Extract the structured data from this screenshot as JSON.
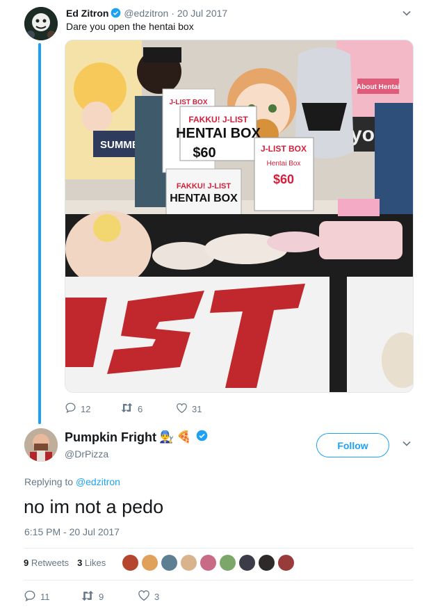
{
  "thread": {
    "parent": {
      "name": "Ed Zitron",
      "handle": "@edzitron",
      "separator": "·",
      "date": "20 Jul 2017",
      "text": "Dare you open the hentai box",
      "counts": {
        "replies": "12",
        "retweets": "6",
        "likes": "31"
      },
      "photo_text": {
        "banner": "J-LIST",
        "sign_box_brand": "FAKKU! J-LIST",
        "sign_box_title": "HENTAI BOX",
        "sign_price": "$60",
        "card_small": "J-LIST BOX",
        "card_right_title": "J-LIST BOX",
        "card_right_sub": "Hentai Box",
        "card_right_price": "$60",
        "box_brand": "FAKKU! J-LIST",
        "box_title": "HENTAI BOX",
        "bg_sign": "SUMME",
        "bg_sign_right": "yo",
        "bg_sign_pink": "About Hentai"
      }
    },
    "reply": {
      "name": "Pumpkin Fright",
      "emoji_1": "👨‍🔧",
      "emoji_2": "🍕",
      "handle": "@DrPizza",
      "follow_label": "Follow",
      "replying_prefix": "Replying to",
      "replying_to": "@edzitron",
      "text": "no im not a pedo",
      "timestamp": "6:15 PM - 20 Jul 2017",
      "retweets_count": "9",
      "retweets_label": "Retweets",
      "likes_count": "3",
      "likes_label": "Likes",
      "counts": {
        "replies": "11",
        "retweets": "9",
        "likes": "3"
      }
    }
  },
  "colors": {
    "accent": "#1da1f2",
    "muted": "#657786",
    "text": "#14171a",
    "banner_red": "#c0282d"
  },
  "icons": [
    "verified-icon",
    "chevron-down-icon",
    "reply-icon",
    "retweet-icon",
    "like-icon"
  ]
}
